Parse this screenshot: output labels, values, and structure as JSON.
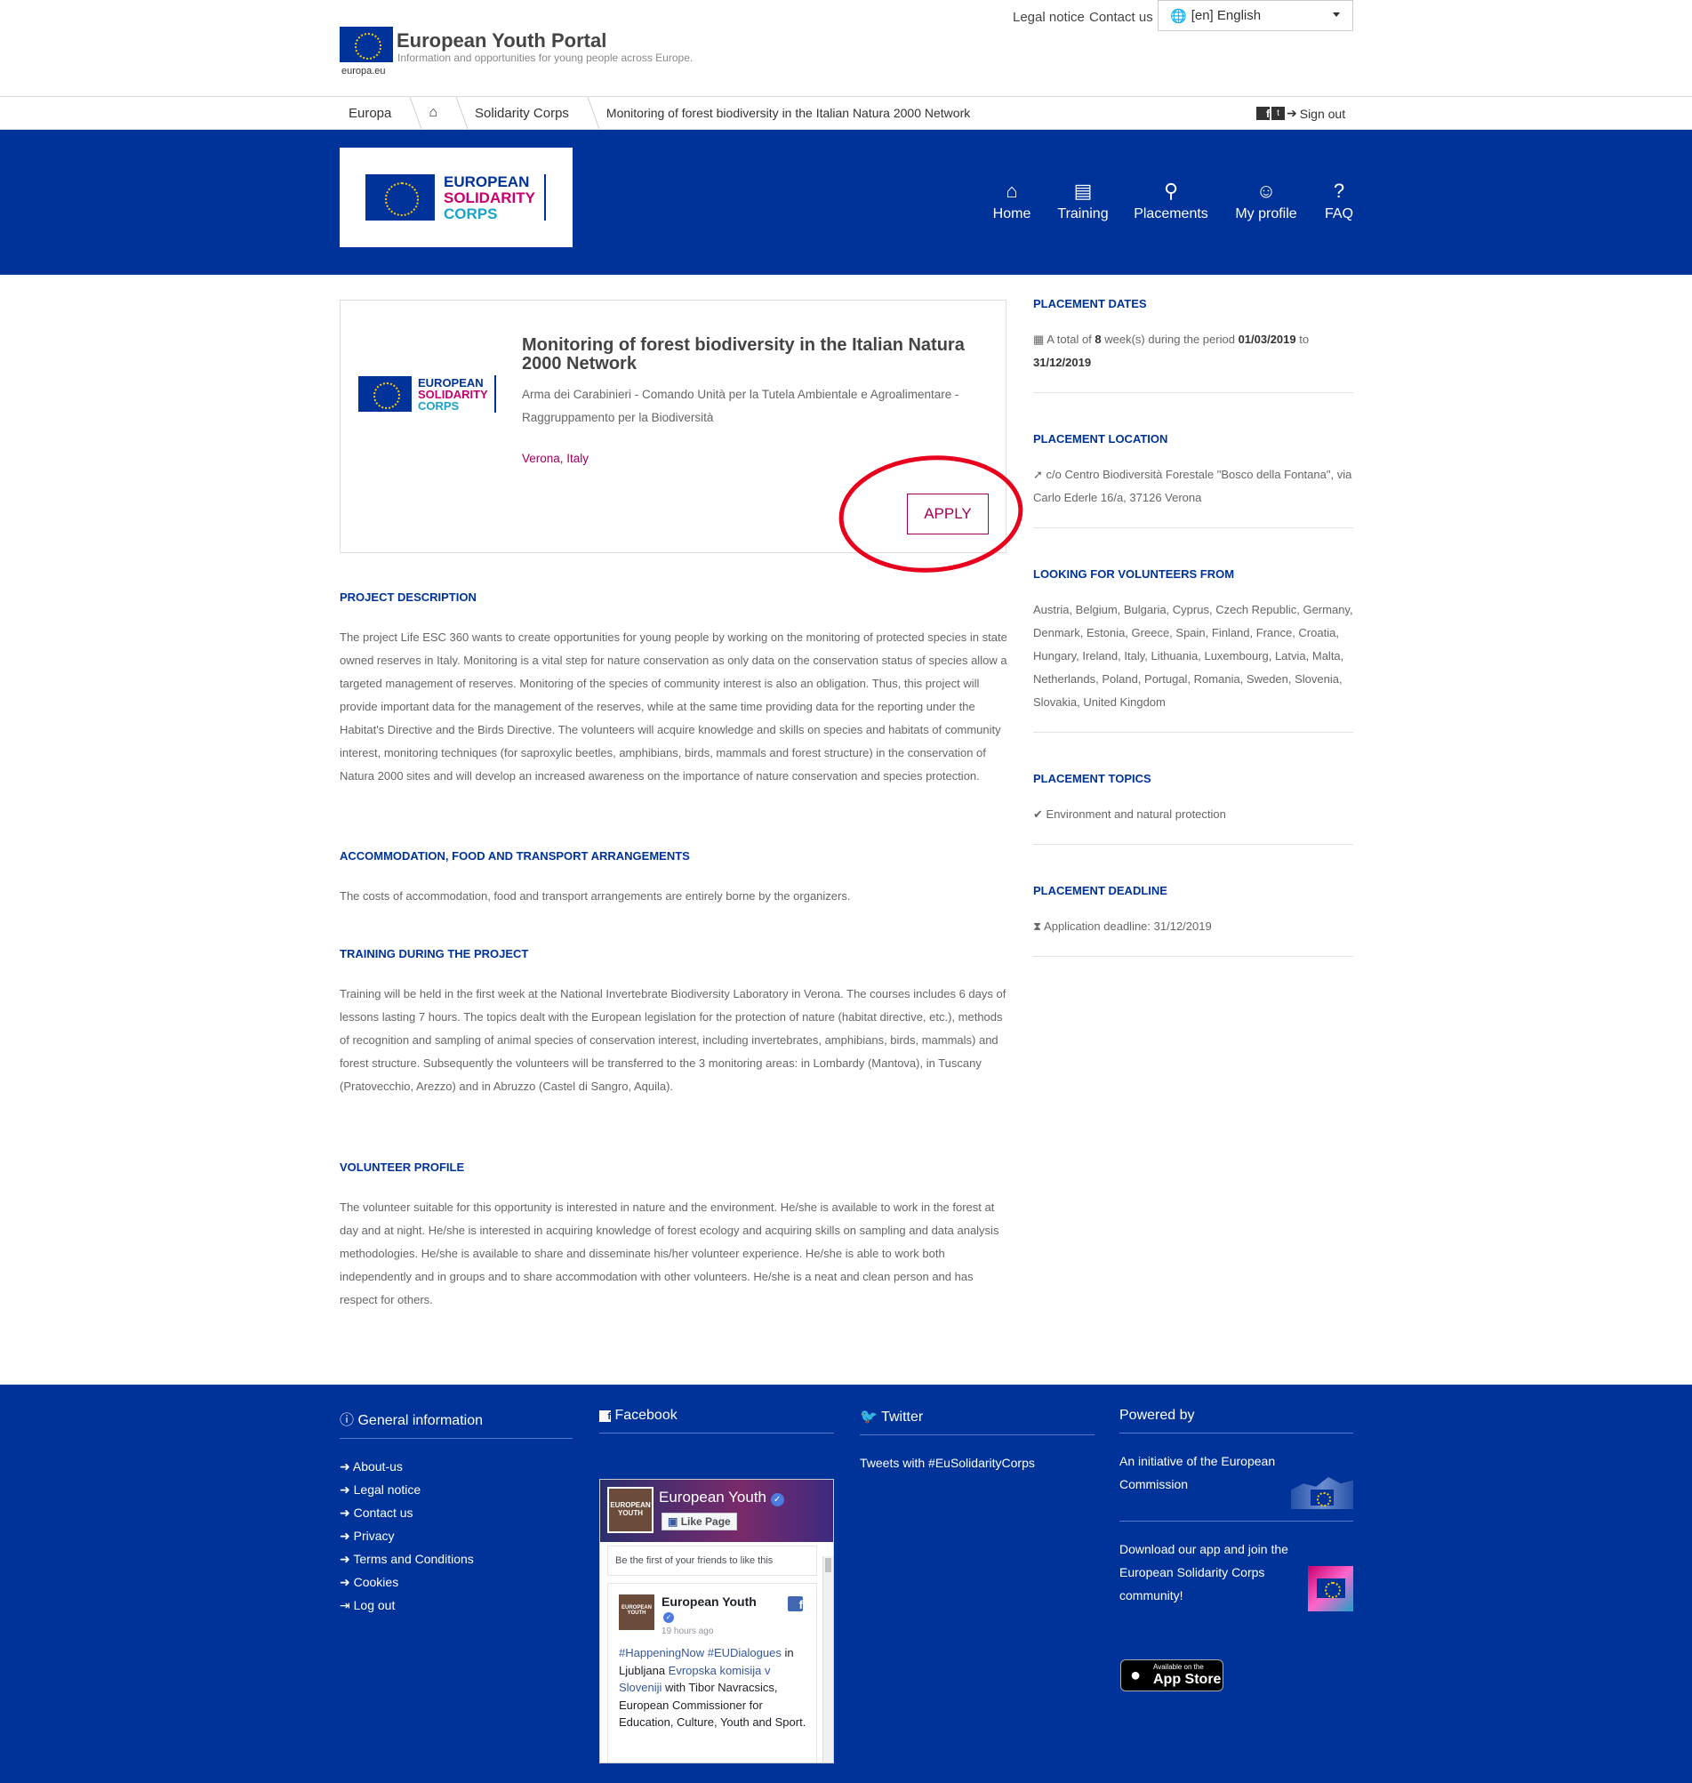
{
  "header": {
    "portal_title": "European Youth Portal",
    "portal_subtitle": "Information and opportunities for young people across Europe.",
    "europa_label": "europa.eu",
    "legal_notice": "Legal notice",
    "contact_us": "Contact us",
    "language": "[en] English"
  },
  "breadcrumb": {
    "items": [
      "Europa",
      "Solidarity Corps",
      "Monitoring of forest biodiversity in the Italian Natura 2000 Network"
    ],
    "sign_out": "Sign out"
  },
  "nav": {
    "logo_line1": "EUROPEAN",
    "logo_line2": "SOLIDARITY",
    "logo_line3": "CORPS",
    "items": [
      "Home",
      "Training",
      "Placements",
      "My profile",
      "FAQ"
    ]
  },
  "placement": {
    "title": "Monitoring of forest biodiversity in the Italian Natura 2000 Network",
    "organisation": "Arma dei Carabinieri - Comando Unità per la Tutela Ambientale e Agroalimentare - Raggruppamento per la Biodiversità",
    "location": "Verona, Italy",
    "apply_label": "APPLY"
  },
  "sections": [
    {
      "heading": "PROJECT DESCRIPTION",
      "text": "The project Life ESC 360 wants to create opportunities for young people by working on the monitoring of protected species in state owned reserves in Italy. Monitoring is a vital step for nature conservation as only data on the conservation status of species allow a targeted management of reserves. Monitoring of the species of community interest is also an obligation. Thus, this project will provide important data for the management of the reserves, while at the same time providing data for the reporting under the Habitat's Directive and the Birds Directive. The volunteers will acquire knowledge and skills on species and habitats of community interest, monitoring techniques (for saproxylic beetles, amphibians, birds, mammals and forest structure) in the conservation of Natura 2000 sites and will develop an increased awareness on the importance of nature conservation and species protection."
    },
    {
      "heading": "ACCOMMODATION, FOOD AND TRANSPORT ARRANGEMENTS",
      "text": "The costs of accommodation, food and transport arrangements are entirely borne by the organizers."
    },
    {
      "heading": "TRAINING DURING THE PROJECT",
      "text": "Training will be held in the first week at the National Invertebrate Biodiversity Laboratory in Verona. The courses includes 6 days of lessons lasting 7 hours. The topics dealt with the European legislation for the protection of nature (habitat directive, etc.), methods of recognition and sampling of animal species of conservation interest, including invertebrates, amphibians, birds, mammals) and forest structure. Subsequently the volunteers will be transferred to the 3 monitoring areas: in Lombardy (Mantova), in Tuscany (Pratovecchio, Arezzo) and in Abruzzo (Castel di Sangro, Aquila)."
    },
    {
      "heading": "VOLUNTEER PROFILE",
      "text": "The volunteer suitable for this opportunity is interested in nature and the environment. He/she is available to work in the forest at day and at night. He/she is interested in acquiring knowledge of forest ecology and acquiring skills on sampling and data analysis methodologies. He/she is available to share and disseminate his/her volunteer experience. He/she is able to work both independently and in groups and to share accommodation with other volunteers. He/she is a neat and clean person and has respect for others."
    }
  ],
  "sidebar": {
    "dates_heading": "PLACEMENT DATES",
    "dates_pre": "A total of ",
    "dates_weeks": "8",
    "dates_mid": " week(s) during the period ",
    "dates_start": "01/03/2019",
    "dates_to": " to ",
    "dates_end": "31/12/2019",
    "location_heading": "PLACEMENT LOCATION",
    "location_text": "c/o Centro Biodiversità Forestale \"Bosco della Fontana\", via Carlo Ederle 16/a, 37126 Verona",
    "volunteers_heading": "LOOKING FOR VOLUNTEERS FROM",
    "volunteers_text": "Austria, Belgium, Bulgaria, Cyprus, Czech Republic, Germany, Denmark, Estonia, Greece, Spain, Finland, France, Croatia, Hungary, Ireland, Italy, Lithuania, Luxembourg, Latvia, Malta, Netherlands, Poland, Portugal, Romania, Sweden, Slovenia, Slovakia, United Kingdom",
    "topics_heading": "PLACEMENT TOPICS",
    "topic": "Environment and natural protection",
    "deadline_heading": "PLACEMENT DEADLINE",
    "deadline_text": "Application deadline: 31/12/2019"
  },
  "footer": {
    "general_heading": "General information",
    "general_links": [
      "About-us",
      "Legal notice",
      "Contact us",
      "Privacy",
      "Terms and Conditions",
      "Cookies",
      "Log out"
    ],
    "facebook_heading": "Facebook",
    "fb_page_name": "European Youth",
    "fb_like": "Like Page",
    "fb_friends": "Be the first of your friends to like this",
    "fb_post_author": "European Youth",
    "fb_post_time": "19 hours ago",
    "fb_post_tags": "#HappeningNow #EUDialogues",
    "fb_post_in": "in Ljubljana ",
    "fb_post_link": "Evropska komisija v Sloveniji",
    "fb_post_rest": " with Tibor Navracsics, European Commissioner for Education, Culture, Youth and Sport.",
    "fb_cover_text": "EUROPEAN YOUTH",
    "twitter_heading": "Twitter",
    "twitter_text": "Tweets with #EuSolidarityCorps",
    "powered_heading": "Powered by",
    "powered_text": "An initiative of the European Commission",
    "app_text": "Download our app and join the European Solidarity Corps community!",
    "appstore_small": "Available on the",
    "appstore_big": "App Store"
  },
  "colors": {
    "eu_blue": "#003399",
    "accent": "#a0005a",
    "annotation": "#e8001c"
  }
}
